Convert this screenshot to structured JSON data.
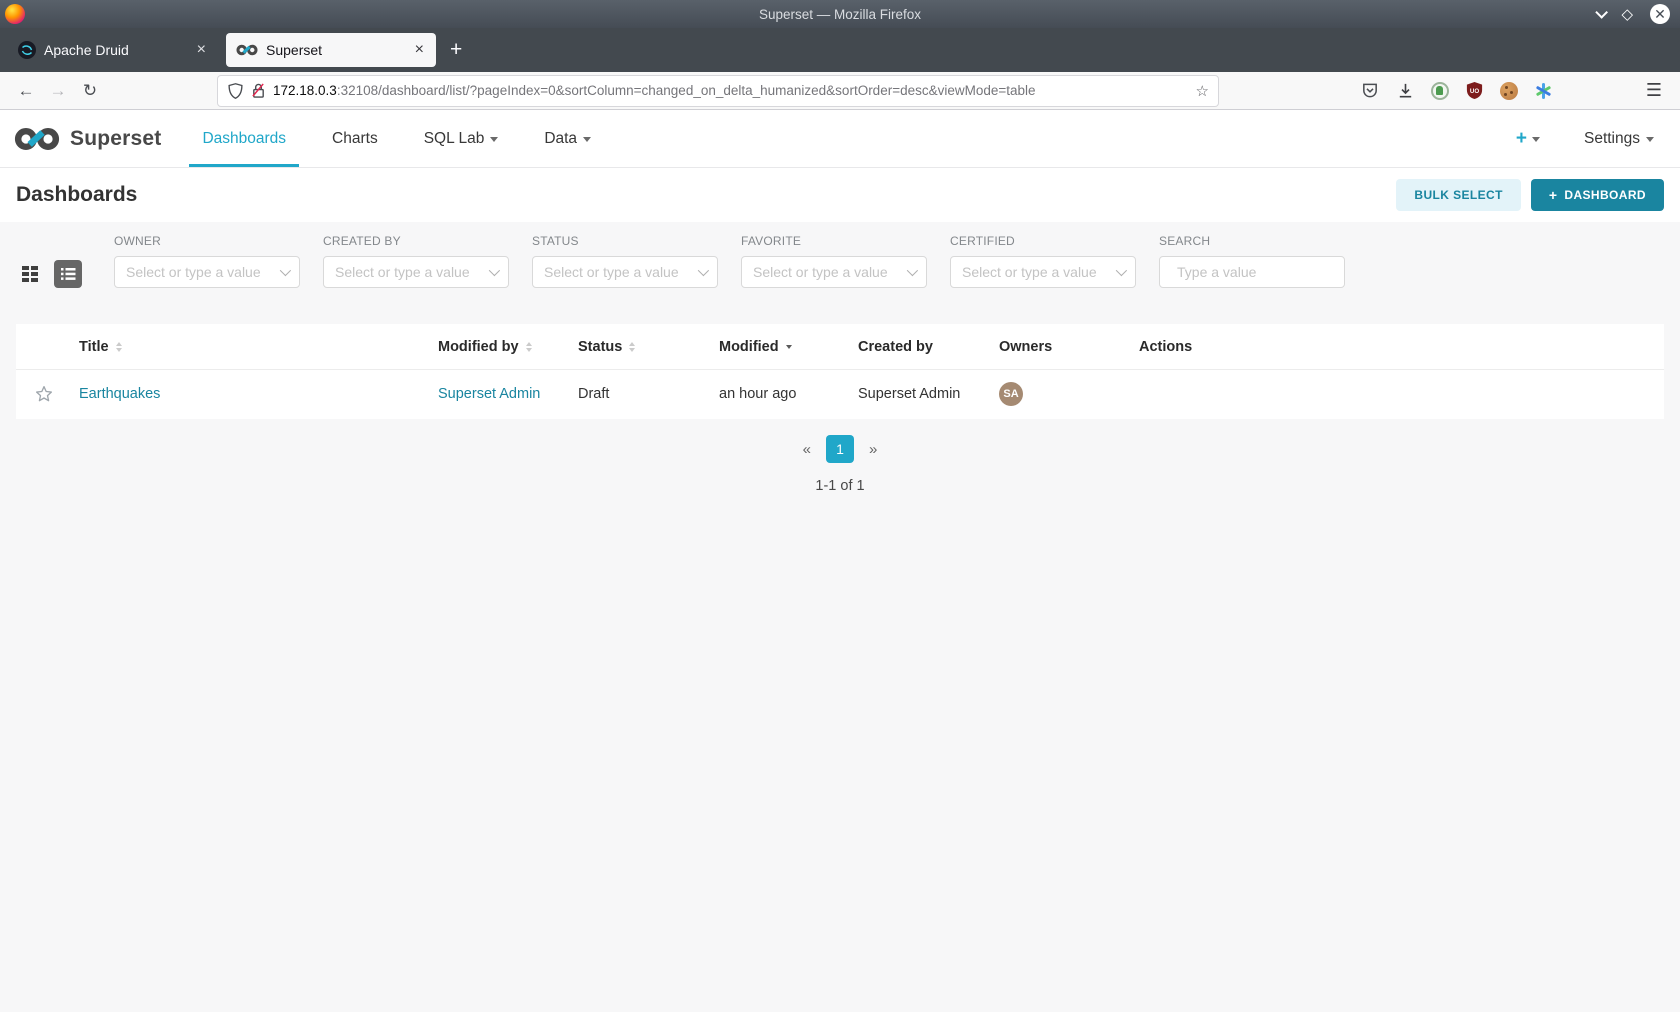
{
  "window": {
    "title": "Superset — Mozilla Firefox"
  },
  "browser": {
    "tabs": [
      {
        "label": "Apache Druid",
        "close": "×"
      },
      {
        "label": "Superset",
        "close": "×"
      }
    ],
    "new_tab": "+",
    "url": {
      "host": "172.18.0.3",
      "rest": ":32108/dashboard/list/?pageIndex=0&sortColumn=changed_on_delta_humanized&sortOrder=desc&viewMode=table"
    }
  },
  "navbar": {
    "brand": "Superset",
    "items": [
      {
        "label": "Dashboards"
      },
      {
        "label": "Charts"
      },
      {
        "label": "SQL Lab"
      },
      {
        "label": "Data"
      }
    ],
    "plus": "+",
    "settings": "Settings"
  },
  "page": {
    "title": "Dashboards",
    "bulk_select": "BULK SELECT",
    "new_dashboard_plus": "+",
    "new_dashboard": "DASHBOARD"
  },
  "filters": {
    "owner": {
      "label": "OWNER",
      "placeholder": "Select or type a value"
    },
    "created_by": {
      "label": "CREATED BY",
      "placeholder": "Select or type a value"
    },
    "status": {
      "label": "STATUS",
      "placeholder": "Select or type a value"
    },
    "favorite": {
      "label": "FAVORITE",
      "placeholder": "Select or type a value"
    },
    "certified": {
      "label": "CERTIFIED",
      "placeholder": "Select or type a value"
    },
    "search": {
      "label": "SEARCH",
      "placeholder": "Type a value"
    }
  },
  "table": {
    "columns": [
      "Title",
      "Modified by",
      "Status",
      "Modified",
      "Created by",
      "Owners",
      "Actions"
    ],
    "rows": [
      {
        "title": "Earthquakes",
        "modified_by": "Superset Admin",
        "status": "Draft",
        "modified": "an hour ago",
        "created_by": "Superset Admin",
        "owner_initials": "SA"
      }
    ]
  },
  "pagination": {
    "prev": "«",
    "page": "1",
    "next": "»",
    "summary": "1-1 of 1"
  },
  "colors": {
    "accent": "#20a7c9",
    "primary_button": "#1a85a0",
    "avatar": "#a58a72",
    "ublock_red": "#7d1d1d"
  }
}
